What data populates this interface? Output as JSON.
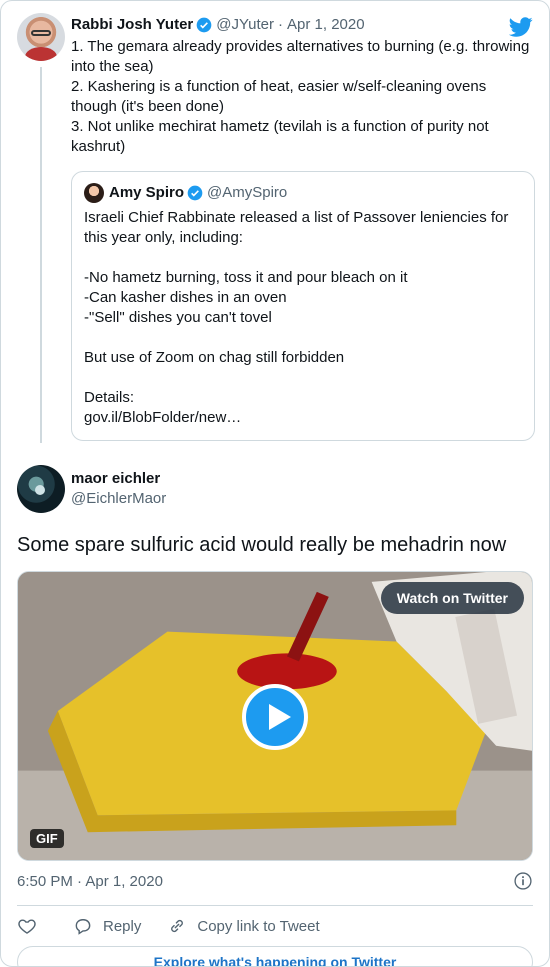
{
  "parent": {
    "name": "Rabbi Josh Yuter",
    "handle": "@JYuter",
    "dot": "·",
    "date": "Apr 1, 2020",
    "lines": [
      "1. The gemara already provides alternatives to burning (e.g. throwing into the sea)",
      "2. Kashering is a function of heat, easier w/self-cleaning ovens though (it's been done)",
      "3. Not unlike mechirat hametz (tevilah is a function of purity not kashrut)"
    ]
  },
  "quote": {
    "name": "Amy Spiro",
    "handle": "@AmySpiro",
    "lines": [
      "Israeli Chief Rabbinate released a list of Passover leniencies for this year only, including:",
      "",
      "-No hametz burning, toss it and pour bleach on it",
      "-Can kasher dishes in an oven",
      "-\"Sell\" dishes you can't tovel",
      "",
      "But use of Zoom on chag still forbidden",
      "",
      "Details:",
      "gov.il/BlobFolder/new…"
    ]
  },
  "reply": {
    "name": "maor eichler",
    "handle": "@EichlerMaor",
    "text": "Some spare sulfuric acid would really be mehadrin now",
    "media": {
      "watch_label": "Watch on Twitter",
      "badge": "GIF"
    },
    "time": "6:50 PM · Apr 1, 2020"
  },
  "actions": {
    "reply_label": "Reply",
    "copy_label": "Copy link to Tweet"
  },
  "explore_label": "Explore what's happening on Twitter",
  "colors": {
    "accent": "#1d9bf0",
    "link": "#1d74c7",
    "muted": "#536471",
    "border": "#cfd9de"
  },
  "icons": [
    "verified-badge-icon",
    "twitter-bird-icon",
    "play-icon",
    "info-icon",
    "heart-icon",
    "reply-icon",
    "link-icon"
  ]
}
